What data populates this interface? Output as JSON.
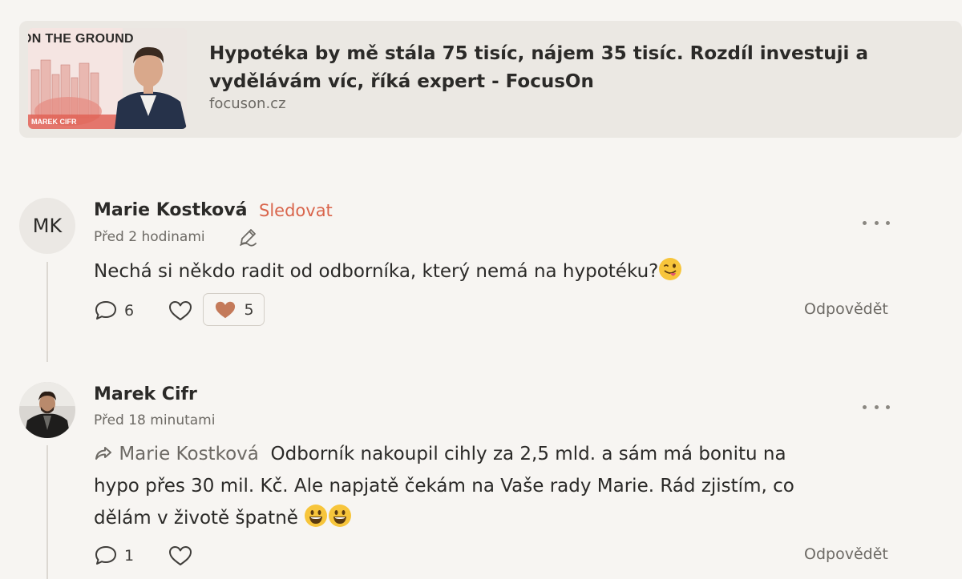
{
  "link_preview": {
    "thumbnail_caption": "ON THE GROUND",
    "thumbnail_name": "MAREK CIFR",
    "title": "Hypotéka by mě stála 75 tisíc, nájem 35 tisíc. Rozdíl investuji a vydělávám víc, říká expert - FocusOn",
    "domain": "focuson.cz"
  },
  "comments": [
    {
      "initials": "MK",
      "author": "Marie Kostková",
      "follow_label": "Sledovat",
      "time": "Před 2 hodinami",
      "text": "Nechá si někdo radit od odborníka, který nemá na hypotéku?",
      "reply_count": "6",
      "like_count": "5",
      "reply_label": "Odpovědět"
    },
    {
      "author": "Marek Cifr",
      "time": "Před 18 minutami",
      "mention": "Marie Kostková",
      "text_line1": "Odborník nakoupil cihly za 2,5 mld. a sám má bonitu na",
      "text_line2": "hypo přes 30 mil. Kč. Ale napjatě čekám na Vaše rady Marie. Rád zjistím, co",
      "text_line3": "dělám v životě špatně",
      "reply_count": "1",
      "reply_label": "Odpovědět"
    }
  ],
  "colors": {
    "background": "#f7f5f2",
    "card": "#ebe8e3",
    "follow": "#d9654c",
    "heart_filled": "#c47a5a"
  },
  "icons": [
    "edit-icon",
    "comment-icon",
    "heart-icon",
    "heart-filled-icon",
    "more-icon",
    "reply-arrow-icon",
    "winking-tongue-emoji",
    "smiley-emoji"
  ]
}
